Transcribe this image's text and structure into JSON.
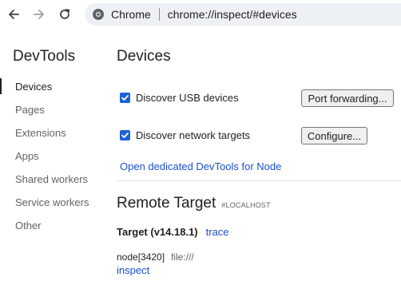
{
  "toolbar": {
    "site_name": "Chrome",
    "url": "chrome://inspect/#devices"
  },
  "sidebar": {
    "title": "DevTools",
    "items": [
      {
        "label": "Devices",
        "active": true
      },
      {
        "label": "Pages",
        "active": false
      },
      {
        "label": "Extensions",
        "active": false
      },
      {
        "label": "Apps",
        "active": false
      },
      {
        "label": "Shared workers",
        "active": false
      },
      {
        "label": "Service workers",
        "active": false
      },
      {
        "label": "Other",
        "active": false
      }
    ]
  },
  "main": {
    "heading": "Devices",
    "discover_usb": {
      "label": "Discover USB devices",
      "checked": true
    },
    "port_forwarding_label": "Port forwarding...",
    "discover_network": {
      "label": "Discover network targets",
      "checked": true
    },
    "configure_label": "Configure...",
    "node_link": "Open dedicated DevTools for Node"
  },
  "remote": {
    "title": "Remote Target",
    "host": "#LOCALHOST",
    "target_name": "Target (v14.18.1)",
    "trace_link": "trace",
    "process": "node[3420]",
    "process_url": "file:///",
    "inspect_link": "inspect"
  },
  "colors": {
    "accent": "#1a62d6",
    "link": "#1a4fcf",
    "omnibox_bg": "#edf0f4"
  },
  "icons": [
    "back-arrow-icon",
    "forward-arrow-icon",
    "reload-icon",
    "chrome-site-icon",
    "checkmark-icon"
  ]
}
